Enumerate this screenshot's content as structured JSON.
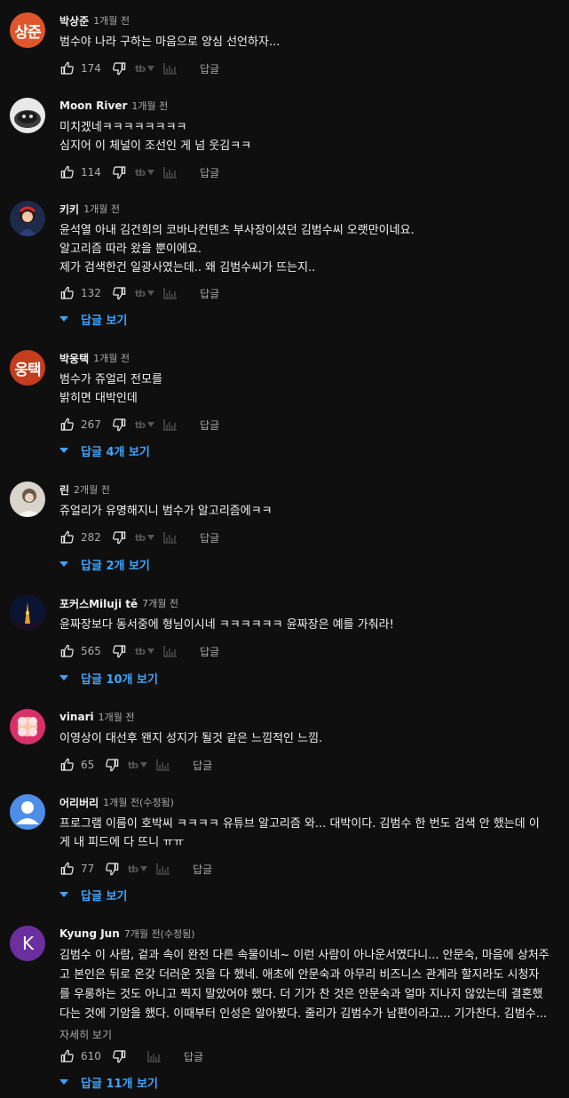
{
  "comments": [
    {
      "author": "박상준",
      "time": "1개월 전",
      "avatar_letter": "상준",
      "avatar_color": "#e0562b",
      "lines": [
        "범수야 나라 구하는 마음으로 양심 선언하자..."
      ],
      "likes": "174",
      "reply_label": "답글"
    },
    {
      "author": "Moon River",
      "time": "1개월 전",
      "avatar_color": "#e8e8e8",
      "lines": [
        "미치겠네ㅋㅋㅋㅋㅋㅋㅋㅋ",
        "심지어 이 체널이 조선인 게 넘 웃김ㅋㅋ"
      ],
      "likes": "114",
      "reply_label": "답글"
    },
    {
      "author": "키키",
      "time": "1개월 전",
      "avatar_color": "#1e2a4a",
      "lines": [
        "윤석열 아내 김건희의 코바나컨텐츠 부사장이셨던 김범수씨 오랫만이네요.",
        "알고리즘 따라 왔을 뿐이에요.",
        "제가 검색한건 일광사였는데.. 왜 김범수씨가 뜨는지.."
      ],
      "likes": "132",
      "reply_label": "답글",
      "replies_label": "답글 보기"
    },
    {
      "author": "박웅택",
      "time": "1개월 전",
      "avatar_letter": "웅택",
      "avatar_color": "#c43d1e",
      "lines": [
        "범수가 쥬얼리 전모를",
        "밝히면 대박인데"
      ],
      "likes": "267",
      "reply_label": "답글",
      "replies_label": "답글 4개 보기"
    },
    {
      "author": "린",
      "time": "2개월 전",
      "avatar_color": "#d9d4cc",
      "lines": [
        "쥬얼리가 유명해지니  범수가 알고리즘에ㅋㅋ"
      ],
      "likes": "282",
      "reply_label": "답글",
      "replies_label": "답글 2개 보기"
    },
    {
      "author": "포커스Miluji tě",
      "time": "7개월 전",
      "avatar_color": "#0b1533",
      "lines": [
        "윤짜장보다 동서중에 형님이시네 ㅋㅋㅋㅋㅋㅋ  윤짜장은 예를 가춰라!"
      ],
      "likes": "565",
      "reply_label": "답글",
      "replies_label": "답글 10개 보기"
    },
    {
      "author": "vinari",
      "time": "1개월 전",
      "avatar_color": "#d8316a",
      "avatar_sticker": "shine",
      "lines": [
        "이영상이 대선후 왠지 성지가 될것 같은 느낌적인 느낌."
      ],
      "likes": "65",
      "reply_label": "답글"
    },
    {
      "author": "어리버리",
      "time": "1개월 전(수정됨)",
      "avatar_color": "#4d8ee8",
      "lines": [
        "프로그램 이름이 호박씨 ㅋㅋㅋㅋ 유튜브 알고리즘 와... 대박이다. 김범수 한 번도 검색 안 했는데 이",
        "게 내 피드에 다 뜨니 ㅠㅠ"
      ],
      "likes": "77",
      "reply_label": "답글",
      "replies_label": "답글 보기"
    },
    {
      "author": "Kyung Jun",
      "time": "7개월 전(수정됨)",
      "avatar_letter": "K",
      "avatar_color": "#6b2fa0",
      "lines": [
        "김범수 이 사람, 겉과 속이 완전 다른 속물이네~ 이런 사람이 아나운서였다니... 안문숙, 마음에 상처주",
        "고 본인은 뒤로 온갖 더러운 짓을 다 했네. 애초에 안문숙과 아무리 비즈니스 관계라 할지라도 시청자",
        "를 우롱하는 것도 아니고 찍지 말았어야 했다. 더 기가 찬 것은 안문숙과 얼마 지나지 않았는데 결혼했",
        "다는 것에 기암을 했다. 이때부터 인성은 알아봤다. 줄리가 김범수가 남편이라고... 기가찬다. 김범수..."
      ],
      "read_more": "자세히 보기",
      "likes": "610",
      "reply_label": "답글",
      "replies_label": "답글 11개 보기"
    }
  ],
  "tb_label": "tb",
  "icons": {
    "like": "thumb-up-icon",
    "dislike": "thumb-down-icon",
    "bars": "bar-chart-icon"
  }
}
